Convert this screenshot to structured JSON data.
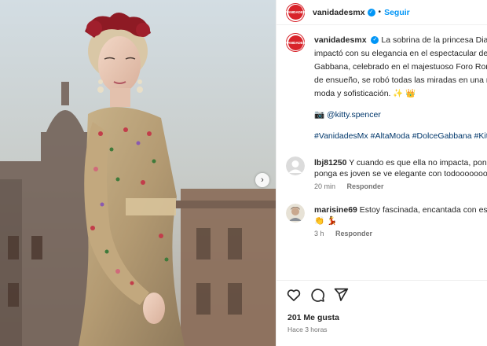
{
  "post": {
    "username": "vanidadesmx",
    "follow_label": "Seguir",
    "separator": "•",
    "brand_logo_text": "VANIDADES"
  },
  "caption": {
    "username": "vanidadesmx",
    "lines": [
      "La sobrina de la princesa Diana,",
      "impactó con su elegancia en el espectacular desf",
      "Gabbana, celebrado en el majestuoso Foro Roma",
      "de ensueño, se robó todas las miradas en una no",
      "moda y sofisticación. ✨ 👑"
    ],
    "camera_emoji": "📷",
    "mention": "@kitty.spencer",
    "hashtags": "#VanidadesMx #AltaModa #DolceGabbana #Kitt"
  },
  "comments": [
    {
      "username": "lbj81250",
      "line1": "Y cuando es que ella no impacta, ponga",
      "line2": "ponga es joven se ve elegante con todoooooooo",
      "time": "20 min",
      "reply_label": "Responder"
    },
    {
      "username": "marisine69",
      "line1": "Estoy fascinada, encantada con ese c",
      "line2": "👏 💃",
      "time": "3 h",
      "reply_label": "Responder"
    }
  ],
  "footer": {
    "likes": "201 Me gusta",
    "time_ago": "Hace 3 horas"
  },
  "icons": {
    "like": "heart-icon",
    "comment": "comment-icon",
    "share": "send-icon",
    "next": "chevron-right-icon",
    "verified": "verified-badge-icon",
    "default_avatar": "user-silhouette-icon"
  },
  "colors": {
    "accent": "#0095f6",
    "brand": "#d8232a",
    "link": "#00376b",
    "muted": "#737373"
  }
}
